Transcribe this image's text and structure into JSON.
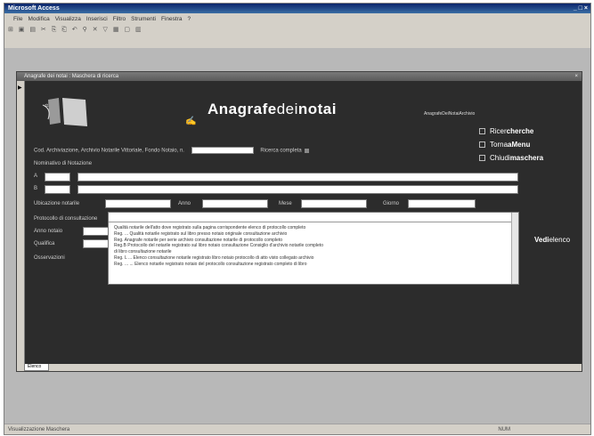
{
  "app": {
    "title": "Microsoft Access",
    "close_glyph": "_ □ ×",
    "menu": [
      "File",
      "Modifica",
      "Visualizza",
      "Inserisci",
      "Filtro",
      "Strumenti",
      "Finestra",
      "?"
    ],
    "toolbar_glyphs": "⊞ ▣ ▤ ✂ ⎘ ⎗ ↶ ⚲ ✕ ▽ ▦ ▢ ▥",
    "status_left": "Visualizzazione Maschera",
    "status_right": "NUM"
  },
  "form": {
    "window_title": "Anagrafe dei notai : Maschera di ricerca",
    "close_glyph": "×",
    "brand_main": "Anagrafe",
    "brand_thin": "dei",
    "brand_end": "notai",
    "brand_sub": "AnagrafeDeiNotaiArchivio",
    "checks": [
      {
        "thin": "Ricer",
        "bold": "cherche"
      },
      {
        "thin": "Torna",
        "bold": "aMenu"
      },
      {
        "thin": "Chiudi",
        "bold": "maschera"
      }
    ],
    "search_line_label": "Cod. Archiviazione, Archivio Notarile Vittoriale, Fondo Notaio, n.",
    "search_line_label2": "Ricerca completa",
    "nominative_label": "Nominativo di Notazione",
    "row_letters": [
      "A",
      "B"
    ],
    "place_label": "Ubicazione notarile",
    "place_fields": [
      "Anno",
      "Mese",
      "Giorno"
    ],
    "protocol_label": "Protocollo di consultazione",
    "left_labels": [
      "Anno notaio",
      "Qualifica",
      "Osservazioni"
    ],
    "memo_rows": [
      "Qualità notarile dell'atto dove registrato sulla pagina corrispondente elenco di protocollo completo",
      "Reg. ... Qualità notarile registrato sul libro presso notaio originale consultazione archivio",
      "Reg. Anagrafe notarile per serie archivio consultazione notarile di protocollo completo",
      "Reg.B Protocollo del notarile registrato sul libro notaio consultazione Consiglio d'archivio notarile completo",
      "    di libro consultazione notarile",
      "Reg. L ... Elenco consultazione notarile registrato libro notaio protocollo di atto visto collegato archivio",
      "Reg. ... ... Elenco notarile registrato notaio del protocollo consultazione registrato completo di libro"
    ],
    "vedi_bold": "Vedi",
    "vedi_thin": "elenco",
    "tab_label": "Elenco"
  }
}
